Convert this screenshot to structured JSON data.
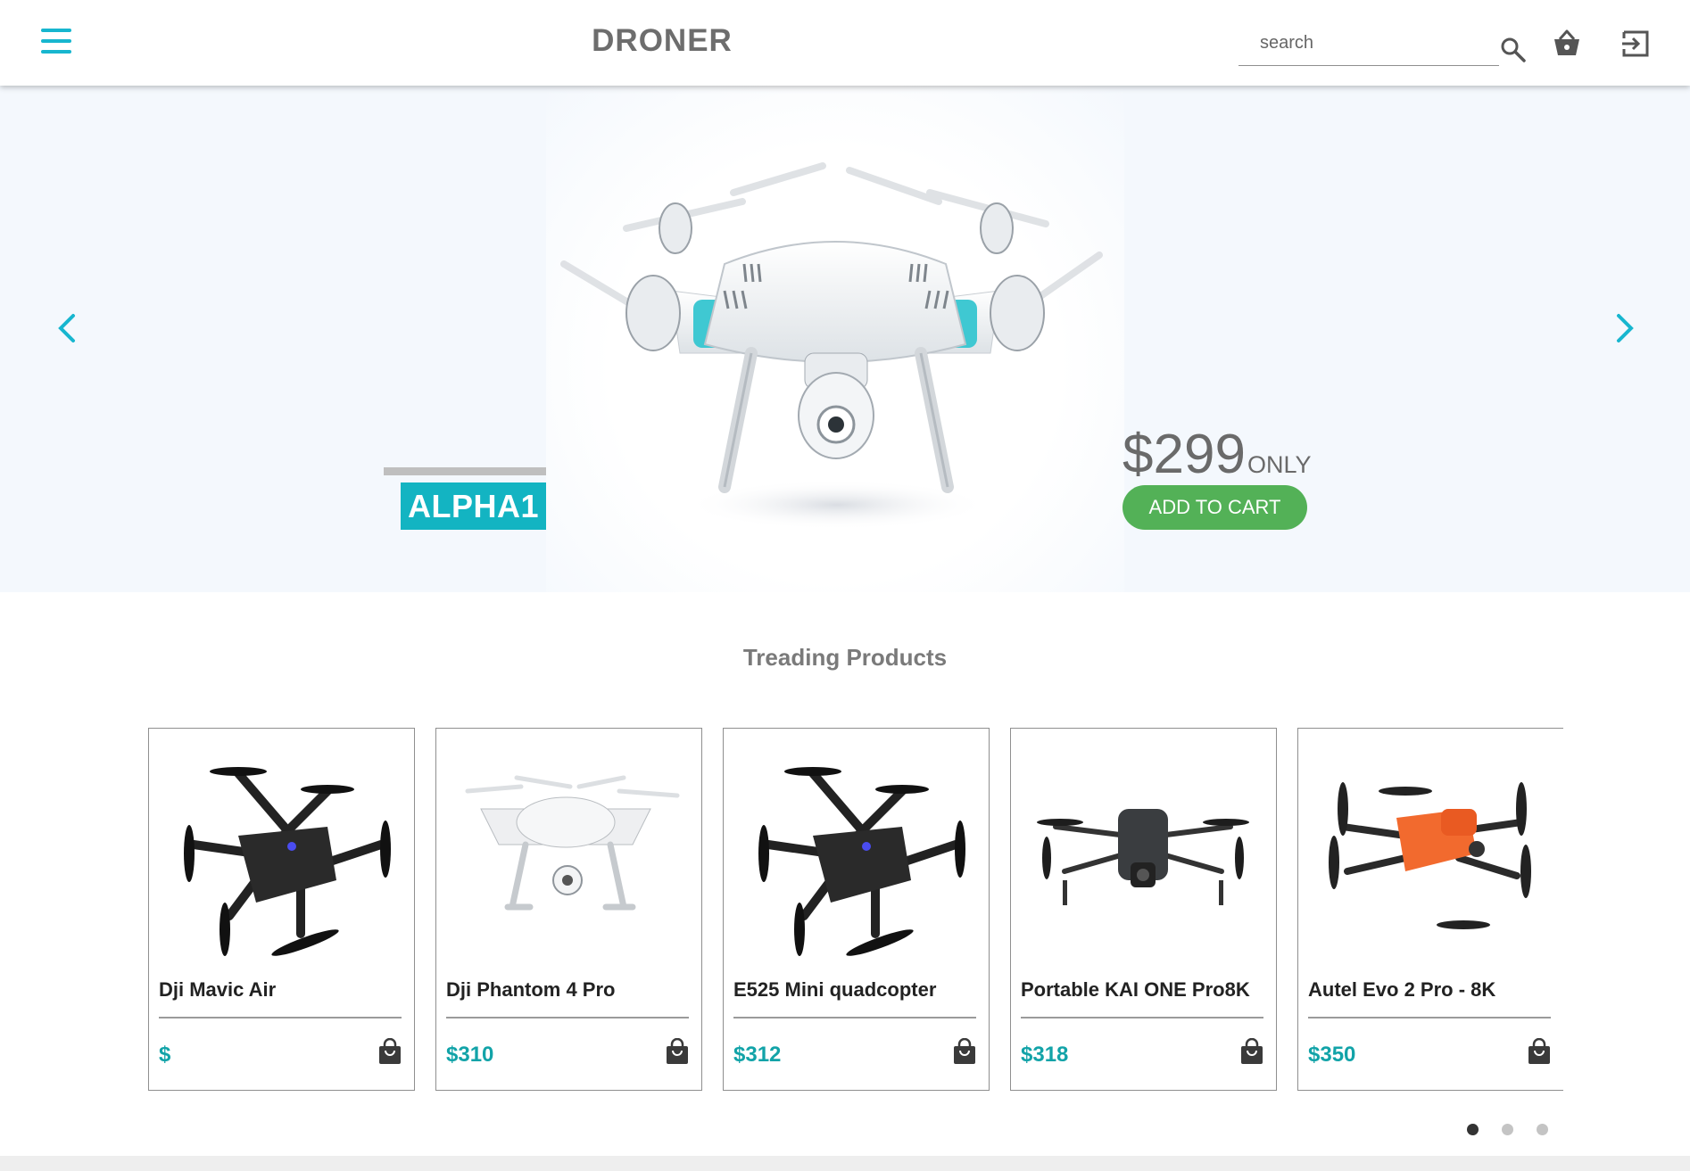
{
  "header": {
    "brand": "DRONER",
    "search_placeholder": "search",
    "icons": [
      "menu-icon",
      "search-icon",
      "basket-icon",
      "exit-icon"
    ],
    "accent_color": "#17b6cf"
  },
  "hero": {
    "name": "ALPHA1",
    "price": "$299",
    "price_suffix": "ONLY",
    "add_to_cart_label": "ADD TO CART",
    "name_tag_color": "#13b4c2",
    "button_color": "#53b157"
  },
  "trending": {
    "title": "Treading Products",
    "products": [
      {
        "name": "Dji Mavic Air",
        "price": "$"
      },
      {
        "name": "Dji Phantom 4 Pro",
        "price": "$310"
      },
      {
        "name": "E525 Mini quadcopter",
        "price": "$312"
      },
      {
        "name": "Portable KAI ONE Pro8K",
        "price": "$318"
      },
      {
        "name": "Autel Evo 2 Pro - 8K",
        "price": "$350"
      }
    ],
    "price_color": "#12a3a8",
    "pagination": {
      "pages": 3,
      "active": 1
    }
  }
}
